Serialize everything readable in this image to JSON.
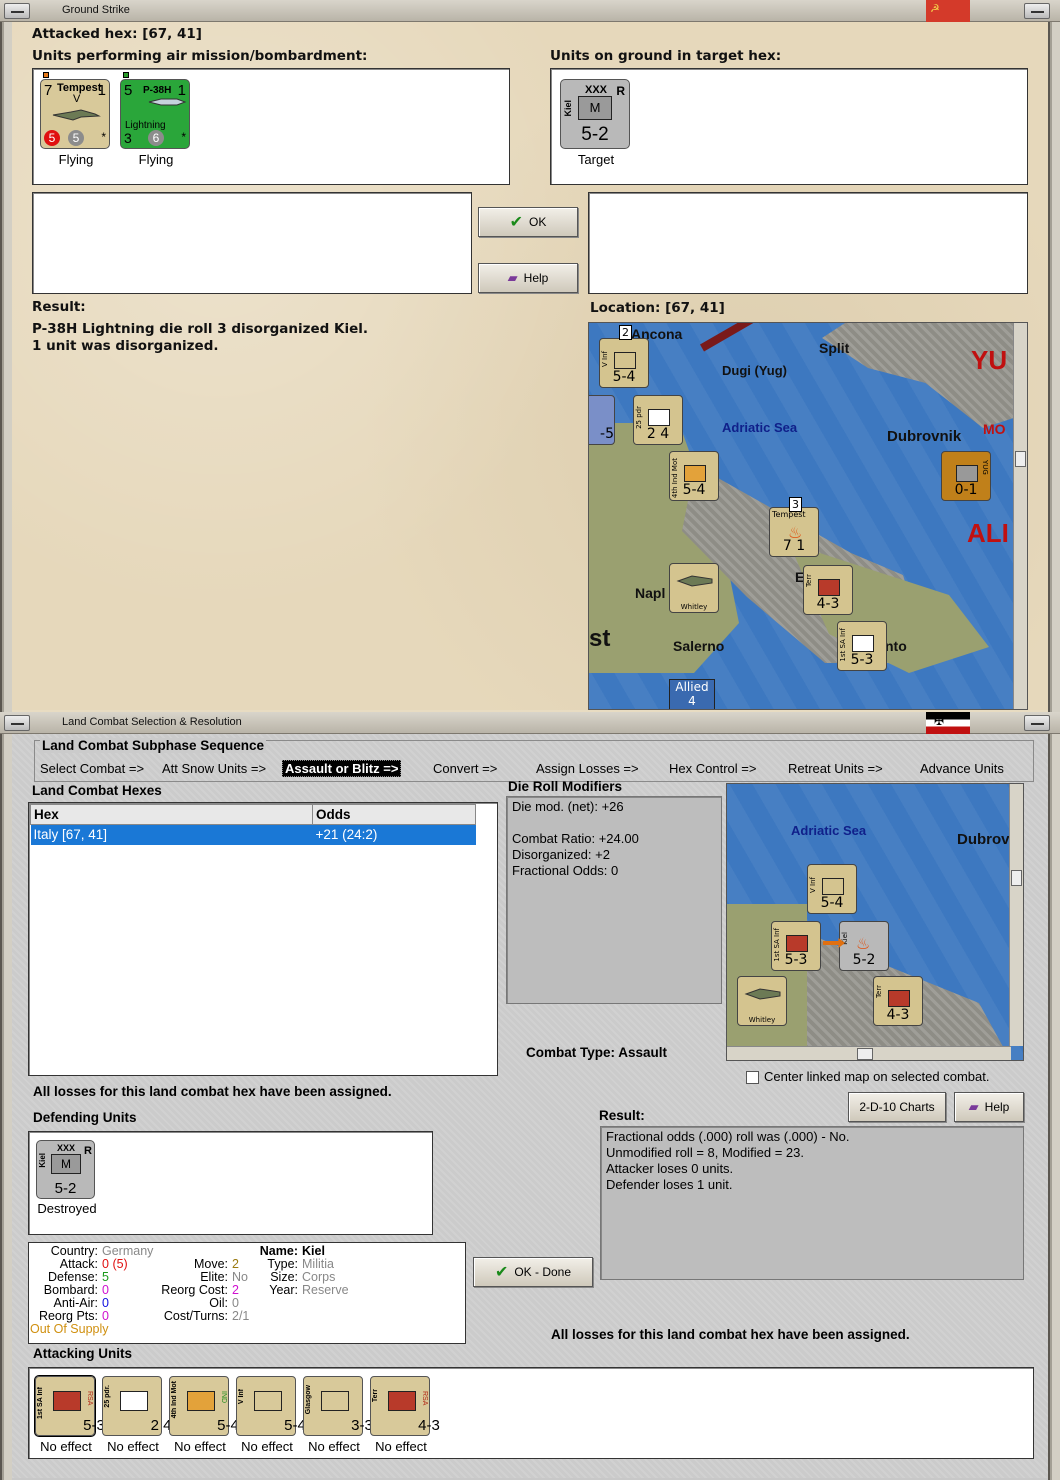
{
  "strike_window": {
    "title": "Ground Strike",
    "attacked_hex_label": "Attacked hex:",
    "attacked_hex_value": "[67, 41]",
    "air_units_label": "Units performing air mission/bombardment:",
    "ground_units_label": "Units on ground in target hex:",
    "air_units": [
      {
        "name": "Tempest",
        "sub": "V",
        "left": "7",
        "right": "1",
        "red": "5",
        "grey": "5",
        "status": "Flying",
        "color": "#d8c99a"
      },
      {
        "name": "P-38H",
        "sub": "Lightning",
        "left": "5",
        "right": "1",
        "red": "3",
        "grey": "6",
        "status": "Flying",
        "color": "#2aa63a"
      }
    ],
    "ground_unit": {
      "name": "Kiel",
      "size": "XXX",
      "type": "M",
      "flag": "R",
      "value": "5-2",
      "status": "Target"
    },
    "ok_label": "OK",
    "help_label": "Help",
    "result_label": "Result:",
    "result_lines": [
      "P-38H Lightning die roll 3 disorganized Kiel.",
      "1 unit was disorganized."
    ],
    "location_label": "Location:",
    "location_value": "[67, 41]",
    "map": {
      "places": [
        "Ancona",
        "Split",
        "Dugi (Yug)",
        "Adriatic Sea",
        "Dubrovnik",
        "YU",
        "MO",
        "ALI",
        "Napl",
        "Salerno",
        "nto",
        "st",
        "E"
      ],
      "counters": [
        {
          "label": "V Inf",
          "value": "5-4"
        },
        {
          "label": "25 pdr",
          "value": "2 4"
        },
        {
          "label": "4th Ind Mot",
          "value": "5-4"
        },
        {
          "label": "Tempest",
          "value": "7 1"
        },
        {
          "label": "Whitley",
          "value": "2 5"
        },
        {
          "label": "Terr",
          "value": "4-3"
        },
        {
          "label": "1st SA Inf",
          "value": "5-3"
        },
        {
          "label": "YUG",
          "value": "0-1"
        },
        {
          "label": "AUS",
          "value": "-5"
        }
      ],
      "allied_label": "Allied",
      "allied_count": "4",
      "stack_count_a": "2",
      "stack_count_b": "3"
    }
  },
  "combat_window": {
    "title": "Land Combat Selection & Resolution",
    "sequence_title": "Land Combat Subphase Sequence",
    "sequence": [
      "Select Combat =>",
      "Att Snow Units =>",
      "Assault or Blitz =>",
      "Convert =>",
      "Assign Losses =>",
      "Hex Control =>",
      "Retreat Units =>",
      "Advance Units"
    ],
    "active_step": "Assault or Blitz =>",
    "hexes_label": "Land Combat Hexes",
    "table_headers": [
      "Hex",
      "Odds"
    ],
    "table_rows": [
      [
        "Italy [67, 41]",
        "+21 (24:2)"
      ]
    ],
    "modifiers_label": "Die Roll Modifiers",
    "modifiers": [
      "Die mod. (net): +26",
      "",
      "Combat Ratio: +24.00",
      "Disorganized: +2",
      "Fractional Odds: 0"
    ],
    "combat_type_label": "Combat Type:",
    "combat_type": "Assault",
    "losses_msg": "All losses for this land combat hex have been assigned.",
    "center_map_label": "Center linked map on selected combat.",
    "charts_label": "2-D-10 Charts",
    "help_label": "Help",
    "defending_label": "Defending Units",
    "defender": {
      "name": "Kiel",
      "size": "XXX",
      "type": "M",
      "flag": "R",
      "value": "5-2",
      "status": "Destroyed"
    },
    "result_label": "Result:",
    "result_lines": [
      "Fractional odds (.000) roll was (.000)  - No.",
      "Unmodified roll = 8, Modified = 23.",
      "Attacker loses 0 units.",
      "Defender loses 1 unit."
    ],
    "ok_done_label": "OK - Done",
    "losses_msg_bottom": "All losses for this land combat hex have been assigned.",
    "attacking_label": "Attacking Units",
    "stats": {
      "country_k": "Country:",
      "country_v": "Germany",
      "attack_k": "Attack:",
      "attack_v": "0",
      "attack_v2": "(5)",
      "defense_k": "Defense:",
      "defense_v": "5",
      "bombard_k": "Bombard:",
      "bombard_v": "0",
      "antiair_k": "Anti-Air:",
      "antiair_v": "0",
      "reorg_k": "Reorg Pts:",
      "reorg_v": "0",
      "supply": "Out Of Supply",
      "move_k": "Move:",
      "move_v": "2",
      "elite_k": "Elite:",
      "elite_v": "No",
      "reorgcost_k": "Reorg Cost:",
      "reorgcost_v": "2",
      "oil_k": "Oil:",
      "oil_v": "0",
      "cost_k": "Cost/Turns:",
      "cost_v": "2/1",
      "name_k": "Name:",
      "name_v": "Kiel",
      "type_k": "Type:",
      "type_v": "Militia",
      "size_k": "Size:",
      "size_v": "Corps",
      "year_k": "Year:",
      "year_v": "Reserve"
    },
    "attackers": [
      {
        "label": "1st SA Inf",
        "side": "RSA",
        "value": "5-3",
        "status": "No effect",
        "sym": "#b83a2a"
      },
      {
        "label": "25 pdr.",
        "side": "",
        "value": "2 4",
        "status": "No effect",
        "sym": "#ffffff"
      },
      {
        "label": "4th Ind Mot",
        "side": "IND",
        "value": "5-4",
        "status": "No effect",
        "sym": "#e3a23a"
      },
      {
        "label": "V Inf",
        "side": "",
        "value": "5-4",
        "status": "No effect",
        "sym": "#d8c99a"
      },
      {
        "label": "Glasgow",
        "side": "",
        "value": "3-3",
        "status": "No effect",
        "sym": "#d8c99a"
      },
      {
        "label": "Terr",
        "side": "RSA",
        "value": "4-3",
        "status": "No effect",
        "sym": "#b83a2a"
      }
    ],
    "mini_map": {
      "places": [
        "Adriatic Sea",
        "Dubrov"
      ],
      "counters": [
        {
          "label": "V Inf",
          "value": "5-4"
        },
        {
          "label": "1st SA Inf",
          "value": "5-3"
        },
        {
          "label": "Kiel",
          "value": "5-2"
        },
        {
          "label": "Whitley",
          "value": "2 5"
        },
        {
          "label": "Terr",
          "value": "4-3"
        }
      ]
    }
  }
}
